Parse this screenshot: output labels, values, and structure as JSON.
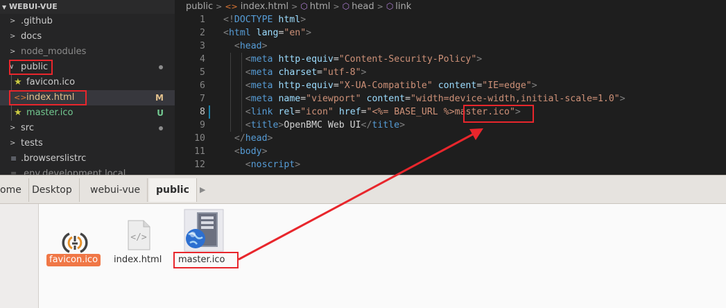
{
  "explorer": {
    "header": "WEBUI-VUE",
    "items": [
      {
        "label": ".github"
      },
      {
        "label": "docs"
      },
      {
        "label": "node_modules"
      },
      {
        "label": "public"
      },
      {
        "label": "favicon.ico"
      },
      {
        "label": "index.html",
        "badge": "M"
      },
      {
        "label": "master.ico",
        "badge": "U"
      },
      {
        "label": "src"
      },
      {
        "label": "tests"
      },
      {
        "label": ".browserslistrc"
      },
      {
        "label": ".env.development.local"
      }
    ],
    "colors": {
      "modified": "#e2c08d",
      "untracked": "#73c991",
      "star": "#cbcb41"
    }
  },
  "breadcrumbs": {
    "folder": "public",
    "file": "index.html",
    "sym1": "html",
    "sym2": "head",
    "sym3": "link"
  },
  "code": {
    "lines": [
      {
        "n": "1",
        "parts": [
          [
            "p",
            "<!"
          ],
          [
            "tag",
            "DOCTYPE"
          ],
          [
            "t",
            " "
          ],
          [
            "attr",
            "html"
          ],
          [
            "p",
            ">"
          ]
        ]
      },
      {
        "n": "2",
        "parts": [
          [
            "p",
            "<"
          ],
          [
            "tag",
            "html"
          ],
          [
            "t",
            " "
          ],
          [
            "attr",
            "lang"
          ],
          [
            "t",
            "="
          ],
          [
            "str",
            "\"en\""
          ],
          [
            "p",
            ">"
          ]
        ]
      },
      {
        "n": "3",
        "parts": [
          [
            "t",
            "  "
          ],
          [
            "p",
            "<"
          ],
          [
            "tag",
            "head"
          ],
          [
            "p",
            ">"
          ]
        ]
      },
      {
        "n": "4",
        "parts": [
          [
            "t",
            "    "
          ],
          [
            "p",
            "<"
          ],
          [
            "tag",
            "meta"
          ],
          [
            "t",
            " "
          ],
          [
            "attr",
            "http-equiv"
          ],
          [
            "t",
            "="
          ],
          [
            "str",
            "\"Content-Security-Policy\""
          ],
          [
            "p",
            ">"
          ]
        ]
      },
      {
        "n": "5",
        "parts": [
          [
            "t",
            "    "
          ],
          [
            "p",
            "<"
          ],
          [
            "tag",
            "meta"
          ],
          [
            "t",
            " "
          ],
          [
            "attr",
            "charset"
          ],
          [
            "t",
            "="
          ],
          [
            "str",
            "\"utf-8\""
          ],
          [
            "p",
            ">"
          ]
        ]
      },
      {
        "n": "6",
        "parts": [
          [
            "t",
            "    "
          ],
          [
            "p",
            "<"
          ],
          [
            "tag",
            "meta"
          ],
          [
            "t",
            " "
          ],
          [
            "attr",
            "http-equiv"
          ],
          [
            "t",
            "="
          ],
          [
            "str",
            "\"X-UA-Compatible\""
          ],
          [
            "t",
            " "
          ],
          [
            "attr",
            "content"
          ],
          [
            "t",
            "="
          ],
          [
            "str",
            "\"IE=edge\""
          ],
          [
            "p",
            ">"
          ]
        ]
      },
      {
        "n": "7",
        "parts": [
          [
            "t",
            "    "
          ],
          [
            "p",
            "<"
          ],
          [
            "tag",
            "meta"
          ],
          [
            "t",
            " "
          ],
          [
            "attr",
            "name"
          ],
          [
            "t",
            "="
          ],
          [
            "str",
            "\"viewport\""
          ],
          [
            "t",
            " "
          ],
          [
            "attr",
            "content"
          ],
          [
            "t",
            "="
          ],
          [
            "str",
            "\"width=device-width,initial-scale=1.0\""
          ],
          [
            "p",
            ">"
          ]
        ]
      },
      {
        "n": "8",
        "parts": [
          [
            "t",
            "    "
          ],
          [
            "p",
            "<"
          ],
          [
            "tag",
            "link"
          ],
          [
            "t",
            " "
          ],
          [
            "attr",
            "rel"
          ],
          [
            "t",
            "="
          ],
          [
            "str",
            "\"icon\""
          ],
          [
            "t",
            " "
          ],
          [
            "attr",
            "href"
          ],
          [
            "t",
            "="
          ],
          [
            "str",
            "\"<%= BASE_URL %>master.ico\""
          ],
          [
            "p",
            ">"
          ]
        ]
      },
      {
        "n": "9",
        "parts": [
          [
            "t",
            "    "
          ],
          [
            "p",
            "<"
          ],
          [
            "tag",
            "title"
          ],
          [
            "p",
            ">"
          ],
          [
            "t",
            "OpenBMC Web UI"
          ],
          [
            "p",
            "</"
          ],
          [
            "tag",
            "title"
          ],
          [
            "p",
            ">"
          ]
        ]
      },
      {
        "n": "10",
        "parts": [
          [
            "t",
            "  "
          ],
          [
            "p",
            "</"
          ],
          [
            "tag",
            "head"
          ],
          [
            "p",
            ">"
          ]
        ]
      },
      {
        "n": "11",
        "parts": [
          [
            "t",
            "  "
          ],
          [
            "p",
            "<"
          ],
          [
            "tag",
            "body"
          ],
          [
            "p",
            ">"
          ]
        ]
      },
      {
        "n": "12",
        "parts": [
          [
            "t",
            "    "
          ],
          [
            "p",
            "<"
          ],
          [
            "tag",
            "noscript"
          ],
          [
            "p",
            ">"
          ]
        ]
      }
    ],
    "current_line": "8"
  },
  "filemanager": {
    "path": [
      "ome",
      "Desktop",
      "webui-vue",
      "public"
    ],
    "files": [
      {
        "label": "favicon.ico",
        "selected": true,
        "icon": "openbmc-logo-icon"
      },
      {
        "label": "index.html",
        "icon": "html-file-icon"
      },
      {
        "label": "master.ico",
        "icon": "server-globe-icon"
      }
    ],
    "colors": {
      "selection": "#f07746"
    }
  },
  "annotation": {
    "color": "#e8262c"
  }
}
